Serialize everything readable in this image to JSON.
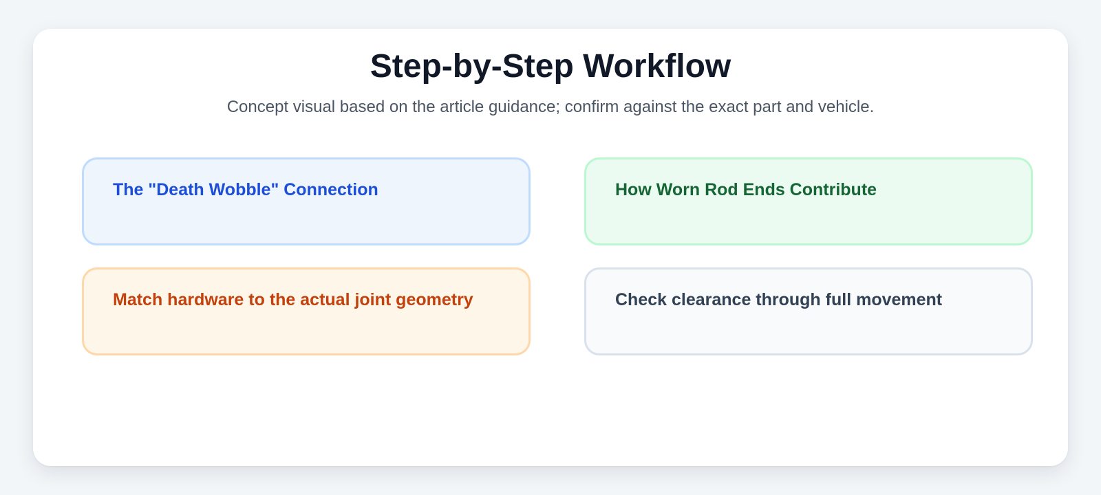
{
  "header": {
    "title": "Step-by-Step Workflow",
    "subtitle": "Concept visual based on the article guidance; confirm against the exact part and vehicle."
  },
  "cards": [
    {
      "title": "The \"Death Wobble\" Connection",
      "accent": "#1d4ed8"
    },
    {
      "title": "How Worn Rod Ends Contribute",
      "accent": "#166534"
    },
    {
      "title": "Match hardware to the actual joint geometry",
      "accent": "#c2410c"
    },
    {
      "title": "Check clearance through full movement",
      "accent": "#334155"
    }
  ]
}
